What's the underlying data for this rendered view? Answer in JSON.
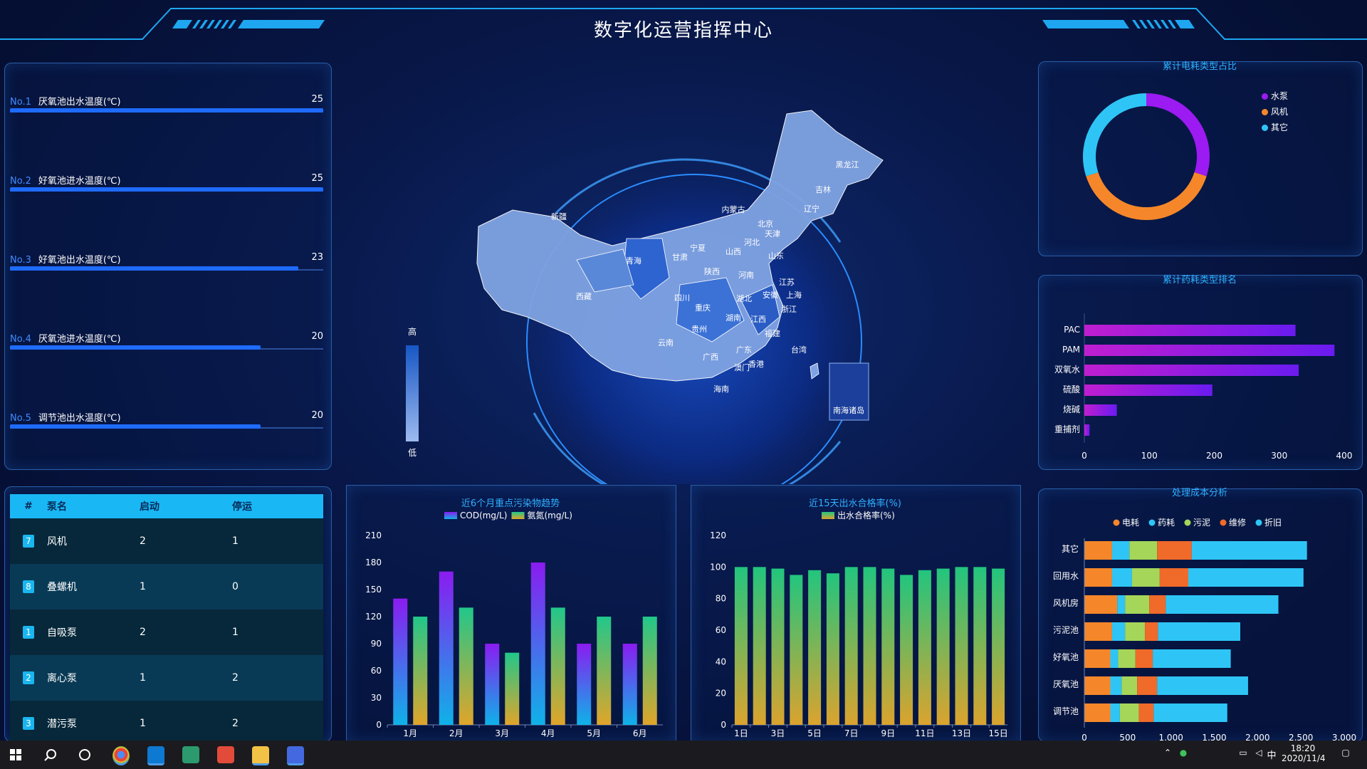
{
  "header": {
    "title": "数字化运营指挥中心"
  },
  "rank_list": [
    {
      "no": "No.1",
      "label": "厌氧池出水温度(℃)",
      "value": 25
    },
    {
      "no": "No.2",
      "label": "好氧池进水温度(℃)",
      "value": 25
    },
    {
      "no": "No.3",
      "label": "好氧池出水温度(℃)",
      "value": 23
    },
    {
      "no": "No.4",
      "label": "厌氧池进水温度(℃)",
      "value": 20
    },
    {
      "no": "No.5",
      "label": "调节池出水温度(℃)",
      "value": 20
    }
  ],
  "rank_max": 25,
  "pump_table": {
    "headers": [
      "#",
      "泵名",
      "启动",
      "停运"
    ],
    "rows": [
      {
        "idx": "7",
        "name": "风机",
        "start": "2",
        "stop": "1"
      },
      {
        "idx": "8",
        "name": "叠螺机",
        "start": "1",
        "stop": "0"
      },
      {
        "idx": "1",
        "name": "自吸泵",
        "start": "2",
        "stop": "1"
      },
      {
        "idx": "2",
        "name": "离心泵",
        "start": "1",
        "stop": "2"
      },
      {
        "idx": "3",
        "name": "潜污泵",
        "start": "1",
        "stop": "2"
      }
    ]
  },
  "map": {
    "legend_high": "高",
    "legend_low": "低",
    "south_sea": "南海诸岛",
    "provinces": [
      "黑龙江",
      "吉林",
      "辽宁",
      "内蒙古",
      "北京",
      "天津",
      "河北",
      "山西",
      "山东",
      "宁夏",
      "甘肃",
      "新疆",
      "青海",
      "陕西",
      "河南",
      "江苏",
      "安徽",
      "上海",
      "西藏",
      "四川",
      "湖北",
      "重庆",
      "浙江",
      "湖南",
      "江西",
      "贵州",
      "福建",
      "云南",
      "台湾",
      "广东",
      "广西",
      "澳门",
      "香港",
      "海南"
    ]
  },
  "colors": {
    "accent": "#2fb0ff",
    "panel_border": "#2a5ea8",
    "bar_blue": "#1f6bff",
    "purple": "#9b1bf2",
    "orange": "#f5872a",
    "cyan": "#2ec5f6",
    "green": "#9ad35a"
  },
  "taskbar": {
    "time": "18:20",
    "date": "2020/11/4",
    "ime": "中"
  },
  "chart_data": [
    {
      "id": "power_pie",
      "type": "pie",
      "title": "累计电耗类型占比",
      "legend": [
        "水泵",
        "风机",
        "其它"
      ],
      "colors": [
        "#9b1bf2",
        "#f5872a",
        "#2ec5f6"
      ],
      "values": [
        30,
        40,
        30
      ]
    },
    {
      "id": "chem_rank",
      "type": "bar",
      "orientation": "horizontal",
      "title": "累计药耗类型排名",
      "categories": [
        "PAC",
        "PAM",
        "双氧水",
        "硫酸",
        "烧碱",
        "重捕剂"
      ],
      "values": [
        325,
        385,
        330,
        197,
        50,
        8
      ],
      "xlim": [
        0,
        400
      ],
      "xticks": [
        0,
        100,
        200,
        300,
        400
      ]
    },
    {
      "id": "pollutant_trend",
      "type": "bar",
      "title": "近6个月重点污染物趋势",
      "categories": [
        "1月",
        "2月",
        "3月",
        "4月",
        "5月",
        "6月"
      ],
      "series": [
        {
          "name": "COD(mg/L)",
          "values": [
            140,
            170,
            90,
            180,
            90,
            90
          ]
        },
        {
          "name": "氨氮(mg/L)",
          "values": [
            120,
            130,
            80,
            130,
            120,
            120
          ]
        }
      ],
      "ylim": [
        0,
        210
      ],
      "yticks": [
        0,
        30,
        60,
        90,
        120,
        150,
        180,
        210
      ]
    },
    {
      "id": "pass_rate",
      "type": "bar",
      "title": "近15天出水合格率(%)",
      "categories": [
        "1日",
        "2日",
        "3日",
        "4日",
        "5日",
        "6日",
        "7日",
        "8日",
        "9日",
        "10日",
        "11日",
        "12日",
        "13日",
        "14日",
        "15日"
      ],
      "xticklabels": [
        "1日",
        "",
        "3日",
        "",
        "5日",
        "",
        "7日",
        "",
        "9日",
        "",
        "11日",
        "",
        "13日",
        "",
        "15日"
      ],
      "series": [
        {
          "name": "出水合格率(%)",
          "values": [
            100,
            100,
            99,
            95,
            98,
            96,
            100,
            100,
            99,
            95,
            98,
            99,
            100,
            100,
            99
          ]
        }
      ],
      "ylim": [
        0,
        120
      ],
      "yticks": [
        0,
        20,
        40,
        60,
        80,
        100,
        120
      ]
    },
    {
      "id": "cost_analysis",
      "type": "bar",
      "orientation": "horizontal",
      "stacked": true,
      "title": "处理成本分析",
      "categories": [
        "其它",
        "回用水",
        "风机房",
        "污泥池",
        "好氧池",
        "厌氧池",
        "调节池"
      ],
      "series": [
        {
          "name": "电耗",
          "color": "#f5872a",
          "values": [
            320,
            320,
            380,
            320,
            300,
            300,
            300
          ]
        },
        {
          "name": "药耗",
          "color": "#2ec5f6",
          "values": [
            200,
            230,
            90,
            150,
            90,
            130,
            110
          ]
        },
        {
          "name": "污泥",
          "color": "#a5d65a",
          "values": [
            320,
            320,
            280,
            230,
            200,
            180,
            220
          ]
        },
        {
          "name": "维修",
          "color": "#f06a2a",
          "values": [
            400,
            330,
            190,
            150,
            200,
            230,
            170
          ]
        },
        {
          "name": "折旧",
          "color": "#2ec5f6",
          "values": [
            1330,
            1330,
            1300,
            950,
            900,
            1050,
            850
          ]
        }
      ],
      "xlim": [
        0,
        3000
      ],
      "xticks": [
        "0",
        "500",
        "1,000",
        "1,500",
        "2,000",
        "2,500",
        "3,000"
      ]
    }
  ]
}
